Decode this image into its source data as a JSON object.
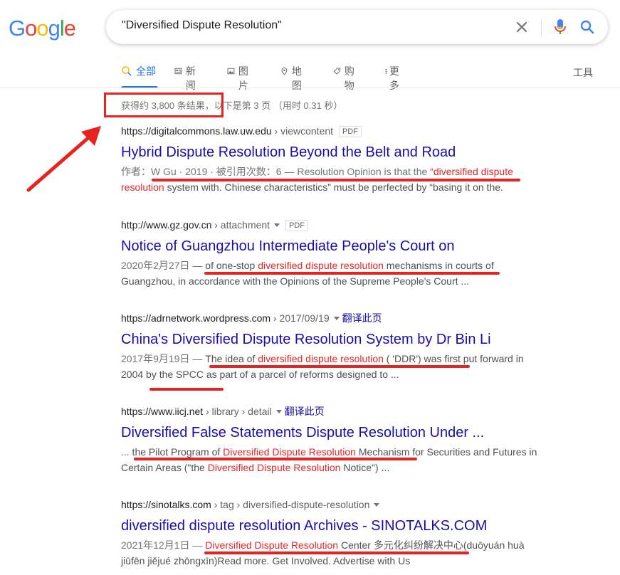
{
  "logo": {
    "letters": [
      "G",
      "o",
      "o",
      "g",
      "l",
      "e"
    ],
    "colors": [
      "#4285f4",
      "#ea4335",
      "#fbbc05",
      "#4285f4",
      "#34a853",
      "#ea4335"
    ]
  },
  "search": {
    "query": "\"Diversified Dispute Resolution\""
  },
  "tabs": [
    {
      "label": "全部",
      "icon": "search-icon"
    },
    {
      "label": "新闻",
      "icon": "news-icon"
    },
    {
      "label": "图片",
      "icon": "image-icon"
    },
    {
      "label": "地图",
      "icon": "map-pin-icon"
    },
    {
      "label": "购物",
      "icon": "tag-icon"
    },
    {
      "label": "更多",
      "icon": "more-vertical-icon"
    }
  ],
  "tools_label": "工具",
  "stats": "获得约 3,800 条结果，以下是第 3 页 （用时 0.31 秒）",
  "results": [
    {
      "domain": "https://digitalcommons.law.uw.edu",
      "path": " › viewcontent",
      "badge": "PDF",
      "title": "Hybrid Dispute Resolution Beyond the Belt and Road",
      "l1_a": "作者：W Gu · 2019 · 被引用次数：6 — Resolution Opinion is that the ",
      "l1_hl": "“diversified dispute",
      "l2_hl": "resolution",
      "l2_b": " system with. Chinese characteristics” must be perfected by “basing it on the."
    },
    {
      "domain": "http://www.gz.gov.cn",
      "path": " › attachment",
      "badge": "PDF",
      "title": "Notice of Guangzhou Intermediate People's Court on",
      "l1_date": "2020年2月27日 — ",
      "l1_a": "of one-stop ",
      "l1_hl": "diversified dispute resolution",
      "l1_b": " mechanisms in courts of",
      "l2": "Guangzhou, in accordance with the Opinions of the Supreme People's Court ..."
    },
    {
      "domain": "https://adrnetwork.wordpress.com",
      "path": " › 2017/09/19",
      "translate": "翻译此页",
      "title": "China's Diversified Dispute Resolution System by Dr Bin Li",
      "l1_date": "2017年9月19日 — ",
      "l1_a": "The idea of ",
      "l1_hl": "diversified dispute resolution",
      "l1_b": " ( 'DDR') was first put forward in",
      "l2": "2004 by the SPCC as part of a parcel of reforms designed to ..."
    },
    {
      "domain": "https://www.iicj.net",
      "path": " › library › detail",
      "translate": "翻译此页",
      "title": "Diversified False Statements Dispute Resolution Under ...",
      "l1_a": "... the Pilot Program of ",
      "l1_hl": "Diversified Dispute Resolution",
      "l1_b": " Mechanism for Securities and Futures in",
      "l2_a": "Certain Areas (\"the ",
      "l2_hl": "Diversified Dispute Resolution",
      "l2_b": " Notice\") ..."
    },
    {
      "domain": "https://sinotalks.com",
      "path": " › tag › diversified-dispute-resolution",
      "title": "diversified dispute resolution Archives - SINOTALKS.COM",
      "l1_date": "2021年12月1日 — ",
      "l1_hl": "Diversified Dispute Resolution",
      "l1_b": " Center 多元化纠纷解决中心(duōyuán huà",
      "l2": "jiūfēn jiějué zhōngxīn)Read more. Get Involved. Advertise with Us"
    }
  ]
}
